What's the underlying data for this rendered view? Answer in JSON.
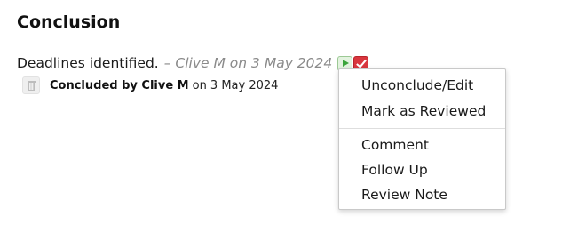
{
  "section": {
    "title": "Conclusion"
  },
  "conclusion": {
    "text": "Deadlines identified.",
    "meta": "– Clive M on 3 May 2024",
    "play_icon": "play-icon",
    "check_icon": "checkmark-icon",
    "check_color": "#d9363e",
    "play_color": "#3aa43a"
  },
  "concluded": {
    "trash_icon": "trash-icon",
    "by": "Concluded by Clive M",
    "on": "on 3 May 2024"
  },
  "context_menu": {
    "items": [
      {
        "label": "Unconclude/Edit"
      },
      {
        "label": "Mark as Reviewed"
      },
      {
        "label": "Comment"
      },
      {
        "label": "Follow Up"
      },
      {
        "label": "Review Note"
      }
    ]
  }
}
